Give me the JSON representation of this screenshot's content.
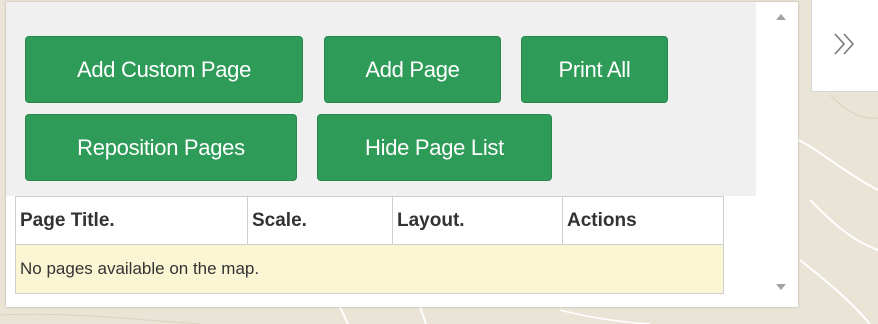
{
  "toolbar": {
    "add_custom_page": "Add Custom Page",
    "add_page": "Add Page",
    "print_all": "Print All",
    "reposition_pages": "Reposition Pages",
    "hide_page_list": "Hide Page List"
  },
  "table": {
    "headers": [
      "Page Title.",
      "Scale.",
      "Layout.",
      "Actions"
    ],
    "empty_message": "No pages available on the map."
  },
  "icons": {
    "collapse_panel": "double-chevron-right-icon",
    "scroll_up": "scroll-up-arrow-icon",
    "scroll_down": "scroll-down-arrow-icon"
  },
  "colors": {
    "button_green": "#2e9b58",
    "empty_row_bg": "#faf6d4",
    "button_area_bg": "#f0f0f0"
  }
}
